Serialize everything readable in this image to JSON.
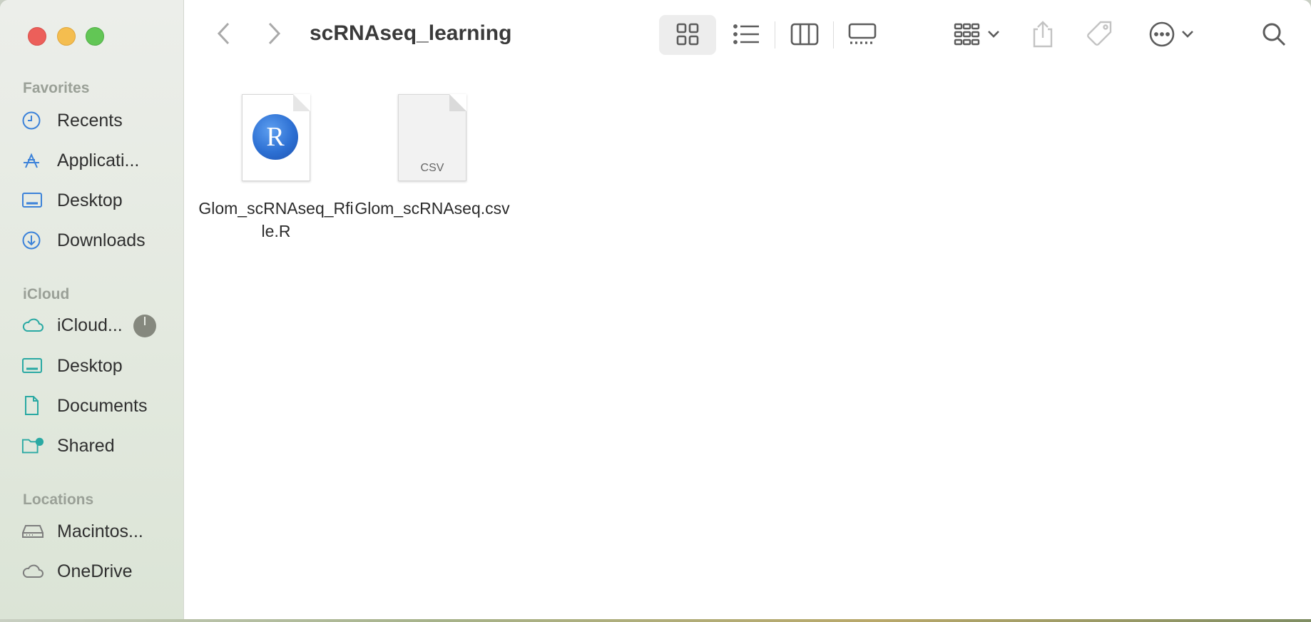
{
  "window": {
    "title": "scRNAseq_learning"
  },
  "sidebar": {
    "sections": [
      {
        "title": "Favorites",
        "items": [
          {
            "label": "Recents",
            "icon": "clock-icon"
          },
          {
            "label": "Applicati...",
            "icon": "applications-icon"
          },
          {
            "label": "Desktop",
            "icon": "desktop-icon"
          },
          {
            "label": "Downloads",
            "icon": "download-icon"
          }
        ]
      },
      {
        "title": "iCloud",
        "items": [
          {
            "label": "iCloud...",
            "icon": "cloud-icon"
          },
          {
            "label": "Desktop",
            "icon": "desktop-icon"
          },
          {
            "label": "Documents",
            "icon": "document-icon"
          },
          {
            "label": "Shared",
            "icon": "shared-folder-icon"
          }
        ]
      },
      {
        "title": "Locations",
        "items": [
          {
            "label": "Macintos...",
            "icon": "hard-drive-icon"
          },
          {
            "label": "OneDrive",
            "icon": "cloud-icon"
          }
        ]
      }
    ]
  },
  "files": [
    {
      "name": "Glom_scRNAseq_Rfile.R",
      "kind": "R script",
      "icon": "r-file-icon"
    },
    {
      "name": "Glom_scRNAseq.csv",
      "kind": "csv",
      "icon_label": "CSV",
      "icon": "csv-file-icon"
    }
  ],
  "colors": {
    "accent": "#3c82d9",
    "close": "#ec5f5a",
    "minimize": "#f4bd4f",
    "maximize": "#62c655"
  }
}
